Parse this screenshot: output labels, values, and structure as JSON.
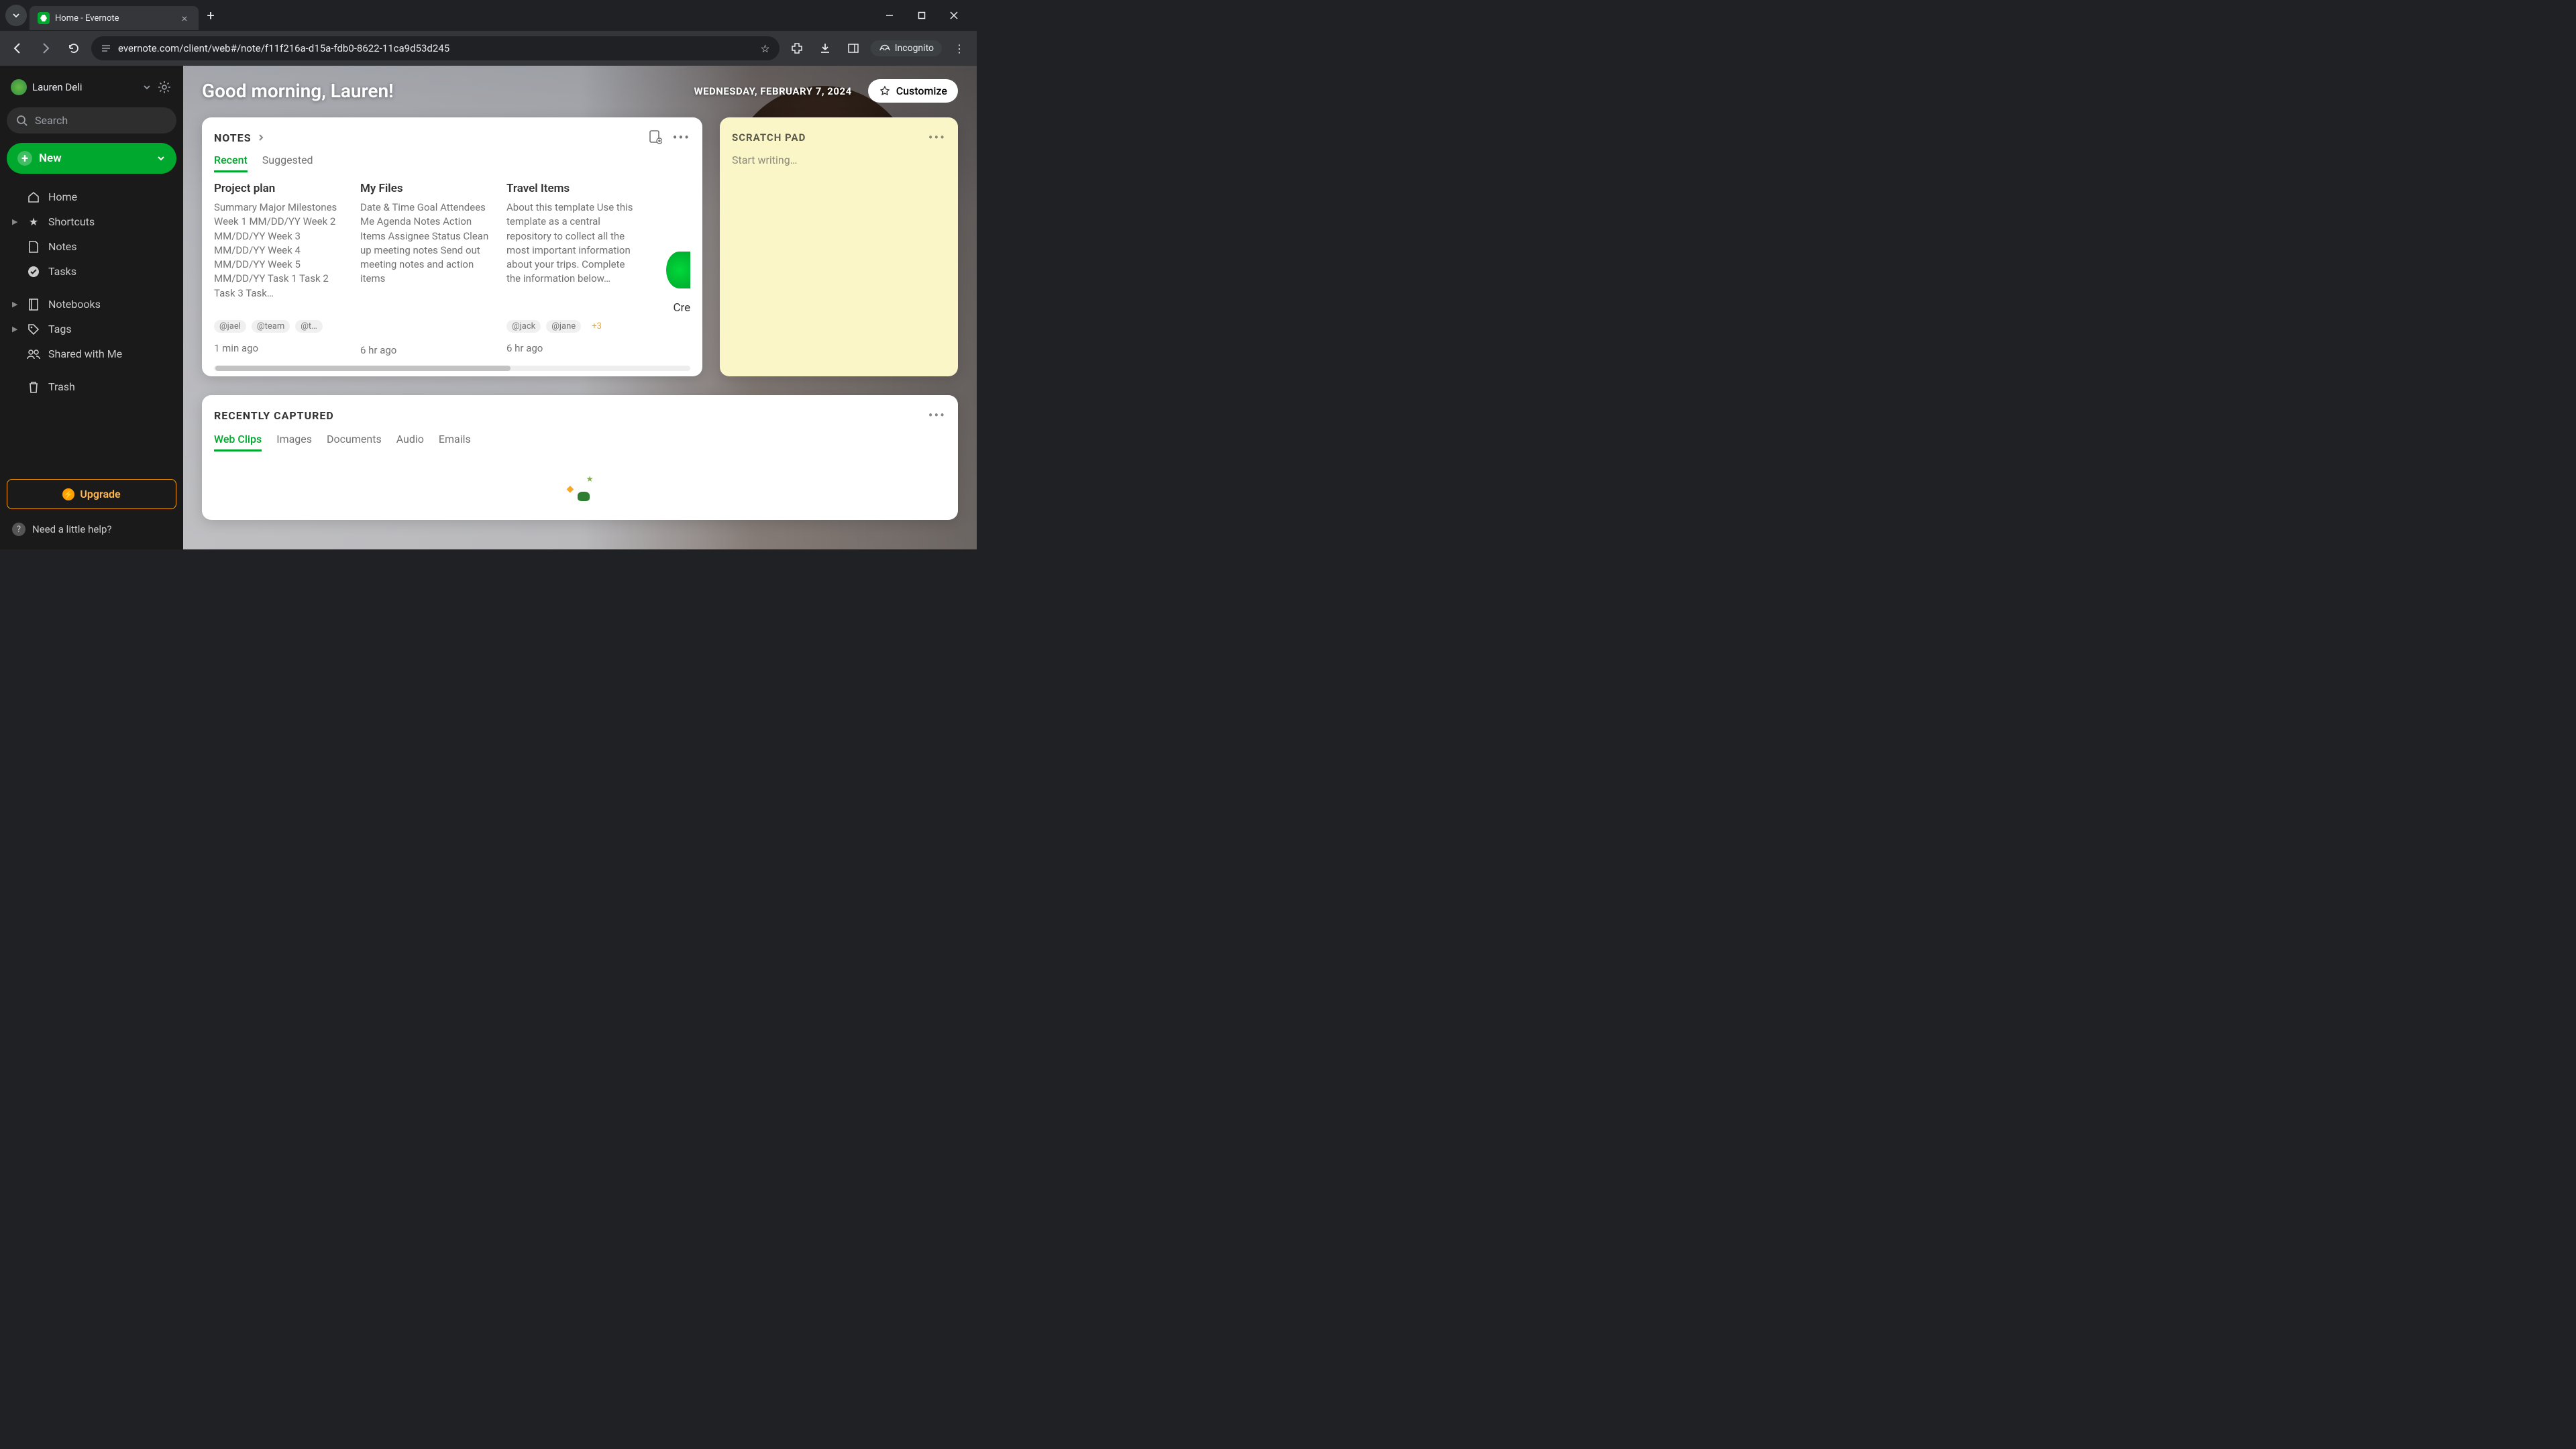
{
  "browser": {
    "tab_title": "Home - Evernote",
    "url": "evernote.com/client/web#/note/f11f216a-d15a-fdb0-8622-11ca9d53d245",
    "incognito_label": "Incognito"
  },
  "sidebar": {
    "user_name": "Lauren Deli",
    "search_placeholder": "Search",
    "new_label": "New",
    "nav": {
      "home": "Home",
      "shortcuts": "Shortcuts",
      "notes": "Notes",
      "tasks": "Tasks",
      "notebooks": "Notebooks",
      "tags": "Tags",
      "shared": "Shared with Me",
      "trash": "Trash"
    },
    "upgrade_label": "Upgrade",
    "help_label": "Need a little help?"
  },
  "header": {
    "greeting": "Good morning, Lauren!",
    "date": "WEDNESDAY, FEBRUARY 7, 2024",
    "customize_label": "Customize"
  },
  "notes_widget": {
    "title": "NOTES",
    "tabs": {
      "recent": "Recent",
      "suggested": "Suggested"
    },
    "cards": [
      {
        "title": "Project plan",
        "body": "Summary Major Milestones Week 1 MM/DD/YY Week 2 MM/DD/YY Week 3 MM/DD/YY Week 4 MM/DD/YY Week 5 MM/DD/YY Task 1 Task 2 Task 3 Task…",
        "tags": [
          "@jael",
          "@team",
          "@t…"
        ],
        "time": "1 min ago"
      },
      {
        "title": "My Files",
        "body": "Date & Time Goal Attendees Me Agenda Notes Action Items Assignee Status Clean up meeting notes Send out meeting notes and action items",
        "tags": [],
        "time": "6 hr ago"
      },
      {
        "title": "Travel Items",
        "body": "About this template Use this template as a central repository to collect all the most important information about your trips. Complete the information below…",
        "tags": [
          "@jack",
          "@jane",
          "+3"
        ],
        "time": "6 hr ago"
      }
    ],
    "create_label": "Create"
  },
  "scratch_pad": {
    "title": "SCRATCH PAD",
    "placeholder": "Start writing…"
  },
  "captured": {
    "title": "RECENTLY CAPTURED",
    "tabs": {
      "web_clips": "Web Clips",
      "images": "Images",
      "documents": "Documents",
      "audio": "Audio",
      "emails": "Emails"
    }
  }
}
